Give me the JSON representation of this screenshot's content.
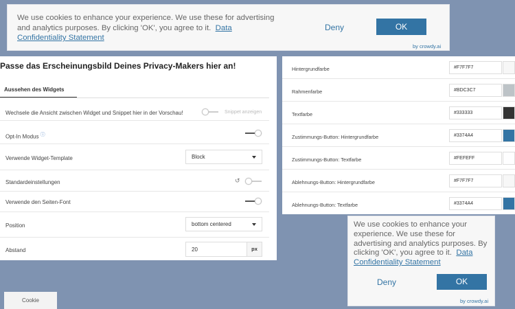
{
  "top_banner": {
    "message": "We use cookies to enhance your experience. We use these for advertising and analytics purposes. By clicking 'OK', you agree to it.",
    "link": "Data Confidentiality Statement",
    "deny": "Deny",
    "ok": "OK",
    "byline": "by crowdy.ai"
  },
  "settings": {
    "title": "Passe das Erscheinungsbild Deines Privacy-Makers hier an!",
    "tab": "Aussehen des Widgets",
    "preview_toggle": {
      "label": "Wechsele die Ansicht zwischen Widget und Snippet hier in der Vorschau!",
      "side_label": "Snippet anzeigen",
      "on": false
    },
    "opt_in": {
      "label": "Opt-In Modus",
      "info_icon": "info-icon",
      "on": true
    },
    "template": {
      "label": "Verwende Widget-Template",
      "value": "Block"
    },
    "defaults": {
      "label": "Standardeinstellungen",
      "reset_icon": "reset-icon",
      "on": false
    },
    "site_font": {
      "label": "Verwende den Seiten-Font",
      "on": true
    },
    "position": {
      "label": "Position",
      "value": "bottom centered"
    },
    "spacing": {
      "label": "Abstand",
      "value": "20",
      "unit": "px"
    }
  },
  "colors": [
    {
      "label": "Hintergrundfarbe",
      "hex": "#F7F7F7",
      "swatch": "#F7F7F7"
    },
    {
      "label": "Rahmenfarbe",
      "hex": "#BDC3C7",
      "swatch": "#BDC3C7"
    },
    {
      "label": "Textfarbe",
      "hex": "#333333",
      "swatch": "#333333"
    },
    {
      "label": "Zustimmungs-Button: Hintergrundfarbe",
      "hex": "#3374A4",
      "swatch": "#3374A4"
    },
    {
      "label": "Zustimmungs-Button: Textfarbe",
      "hex": "#FEFEFF",
      "swatch": "#FEFEFF"
    },
    {
      "label": "Ablehnungs-Button: Hintergrundfarbe",
      "hex": "#F7F7F7",
      "swatch": "#F7F7F7"
    },
    {
      "label": "Ablehnungs-Button: Textfarbe",
      "hex": "#3374A4",
      "swatch": "#3374A4"
    }
  ],
  "popup": {
    "message": "We use cookies to enhance your experience. We use these for advertising and analytics purposes. By clicking 'OK', you agree to it.",
    "link": "Data Confidentiality Statement",
    "deny": "Deny",
    "ok": "OK",
    "byline": "by crowdy.ai"
  },
  "cookie_tab": "Cookie"
}
